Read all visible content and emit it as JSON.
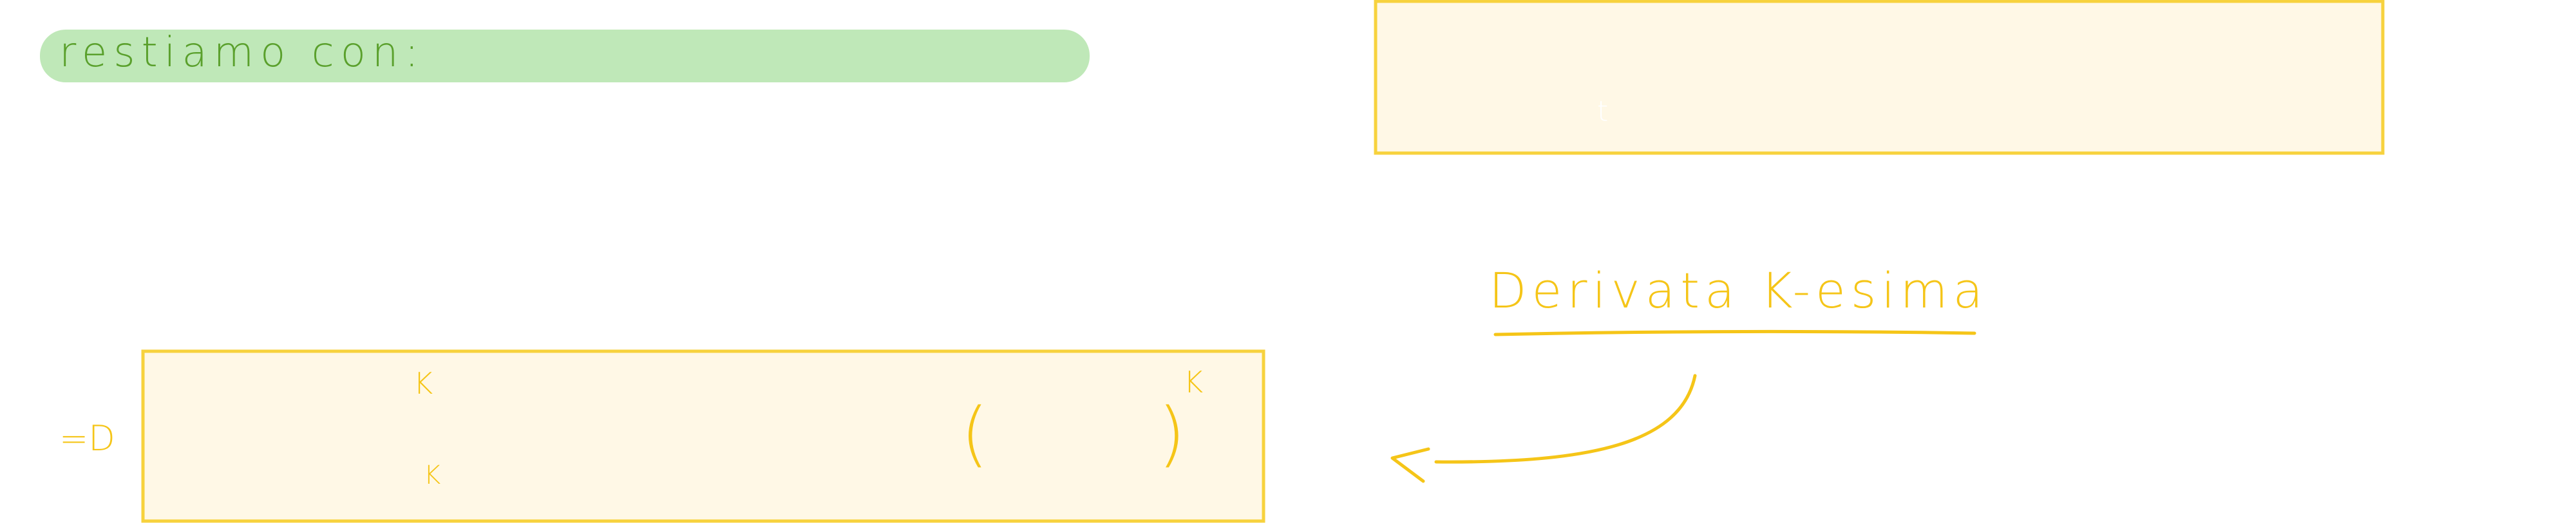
{
  "note": {
    "heading": {
      "text": "restiamo con:",
      "color": "#5aa02c",
      "highlight_color": "#bfe8b8"
    },
    "derivative_label": {
      "text": "Derivata K-esima",
      "color": "#f5c518"
    },
    "implies_symbol": "=D",
    "box_fill": "#fff8e6",
    "box_stroke": "#f7d23d",
    "box_marks": {
      "sup_k": "K",
      "sub_k": "K",
      "paren_open": "(",
      "paren_close": ")",
      "outer_k": "K",
      "t_mark": "t"
    }
  }
}
